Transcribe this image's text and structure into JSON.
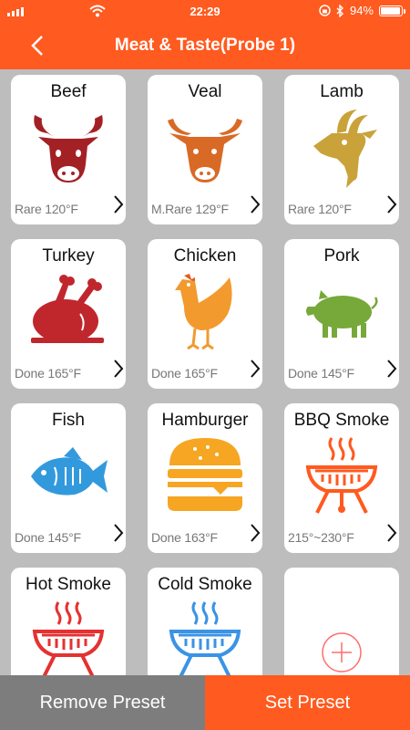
{
  "status": {
    "time": "22:29",
    "battery": "94%",
    "battery_level": 0.94
  },
  "nav": {
    "title": "Meat & Taste(Probe 1)"
  },
  "presets": [
    {
      "name": "Beef",
      "temp": "Rare 120°F",
      "icon": "cow-icon",
      "color": "#a32125"
    },
    {
      "name": "Veal",
      "temp": "M.Rare 129°F",
      "icon": "calf-icon",
      "color": "#d86a26"
    },
    {
      "name": "Lamb",
      "temp": "Rare 120°F",
      "icon": "goat-icon",
      "color": "#c9a23a"
    },
    {
      "name": "Turkey",
      "temp": "Done 165°F",
      "icon": "turkey-icon",
      "color": "#c0272d"
    },
    {
      "name": "Chicken",
      "temp": "Done 165°F",
      "icon": "chicken-icon",
      "color": "#f29a2e"
    },
    {
      "name": "Pork",
      "temp": "Done 145°F",
      "icon": "pig-icon",
      "color": "#77a83a"
    },
    {
      "name": "Fish",
      "temp": "Done 145°F",
      "icon": "fish-icon",
      "color": "#3399dd"
    },
    {
      "name": "Hamburger",
      "temp": "Done 163°F",
      "icon": "hamburger-icon",
      "color": "#f6a623"
    },
    {
      "name": "BBQ Smoke",
      "temp": "215°~230°F",
      "icon": "grill-icon",
      "color": "#ff5a1f"
    },
    {
      "name": "Hot Smoke",
      "temp": "",
      "icon": "grill-icon",
      "color": "#e53131"
    },
    {
      "name": "Cold Smoke",
      "temp": "",
      "icon": "grill-icon",
      "color": "#3a93e6"
    }
  ],
  "buttons": {
    "remove": "Remove Preset",
    "set": "Set Preset"
  },
  "colors": {
    "accent": "#ff5a1f",
    "remove_bg": "#7d7d7d"
  }
}
